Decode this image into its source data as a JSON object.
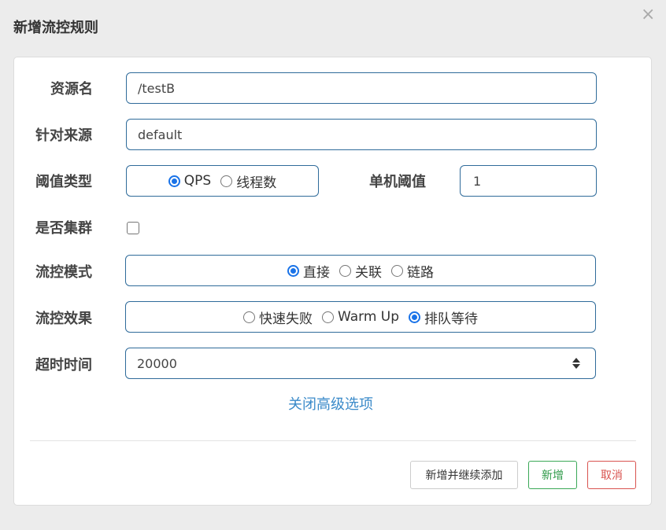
{
  "dialog": {
    "title": "新增流控规则",
    "close_glyph": "×"
  },
  "form": {
    "resource": {
      "label": "资源名",
      "value": "/testB"
    },
    "origin": {
      "label": "针对来源",
      "value": "default"
    },
    "threshold_type": {
      "label": "阈值类型",
      "options": [
        "QPS",
        "线程数"
      ],
      "selected": "QPS"
    },
    "single_threshold": {
      "label": "单机阈值",
      "value": "1"
    },
    "cluster": {
      "label": "是否集群",
      "checked": false
    },
    "flow_mode": {
      "label": "流控模式",
      "options": [
        "直接",
        "关联",
        "链路"
      ],
      "selected": "直接"
    },
    "flow_effect": {
      "label": "流控效果",
      "options": [
        "快速失败",
        "Warm Up",
        "排队等待"
      ],
      "selected": "排队等待"
    },
    "timeout": {
      "label": "超时时间",
      "value": "20000"
    },
    "advanced_toggle": "关闭高级选项"
  },
  "footer": {
    "add_continue": "新增并继续添加",
    "add": "新增",
    "cancel": "取消"
  },
  "colors": {
    "accent": "#1a73e8",
    "link": "#3a8ac9",
    "success": "#2e9a48",
    "danger": "#d9534f",
    "input_border": "#2f6b9a"
  }
}
